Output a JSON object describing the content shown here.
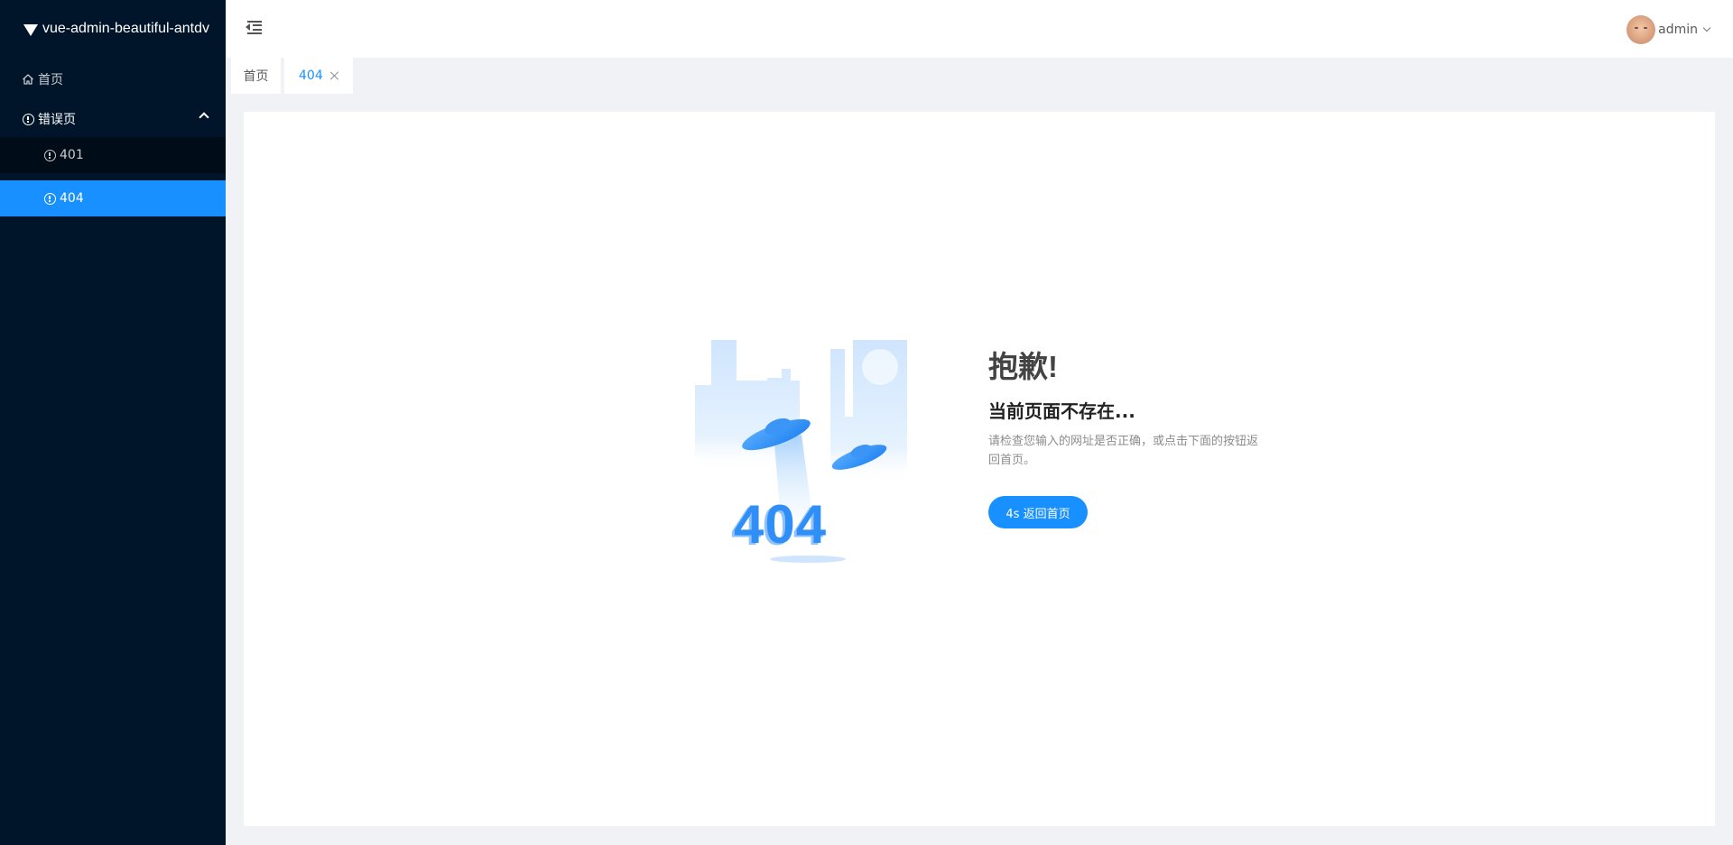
{
  "app": {
    "title": "vue-admin-beautiful-antdv"
  },
  "sidebar": {
    "items": [
      {
        "label": "首页",
        "icon": "home-icon"
      },
      {
        "label": "错误页",
        "icon": "exclamation-circle-icon",
        "expanded": true,
        "children": [
          {
            "label": "401",
            "icon": "exclamation-circle-icon",
            "active": false
          },
          {
            "label": "404",
            "icon": "exclamation-circle-icon",
            "active": true
          }
        ]
      }
    ]
  },
  "header": {
    "user": {
      "name": "admin"
    }
  },
  "tabs": [
    {
      "label": "首页",
      "active": false,
      "closable": false
    },
    {
      "label": "404",
      "active": true,
      "closable": true
    }
  ],
  "page": {
    "illustration_text": "404",
    "oops": "抱歉!",
    "headline": "当前页面不存在...",
    "info": "请检查您输入的网址是否正确，或点击下面的按钮返回首页。",
    "button_label": "4s 返回首页"
  },
  "colors": {
    "sidebar_bg": "#001529",
    "submenu_bg": "#000c17",
    "accent": "#1890ff",
    "page_bg": "#f0f2f5"
  }
}
